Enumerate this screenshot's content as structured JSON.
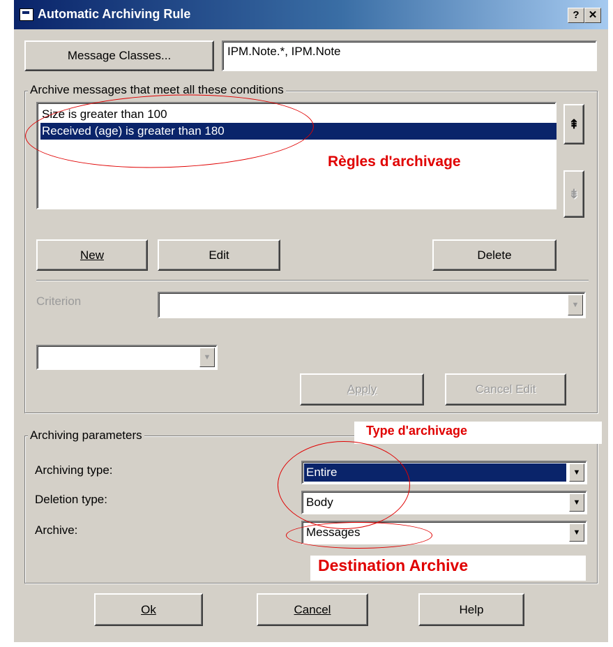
{
  "window": {
    "title": "Automatic Archiving Rule",
    "help_caption": "?",
    "close_caption": "✕"
  },
  "message_classes": {
    "button_label": "Message Classes...",
    "value": "IPM.Note.*, IPM.Note"
  },
  "conditions": {
    "group_label": "Archive messages that meet all these conditions",
    "items": [
      {
        "text": "Size is greater than 100",
        "selected": false
      },
      {
        "text": "Received (age) is greater than 180",
        "selected": true
      }
    ],
    "move_up_icon": "move-up-icon",
    "move_down_icon": "move-down-icon",
    "new_label": "New",
    "edit_label": "Edit",
    "delete_label": "Delete",
    "criterion_label": "Criterion",
    "criterion_value": "",
    "operator_value": "",
    "apply_label": "Apply",
    "cancel_edit_label": "Cancel Edit"
  },
  "parameters": {
    "group_label": "Archiving parameters",
    "archiving_type_label": "Archiving type:",
    "archiving_type_value": "Entire",
    "deletion_type_label": "Deletion type:",
    "deletion_type_value": "Body",
    "archive_label": "Archive:",
    "archive_value": "Messages"
  },
  "footer": {
    "ok_label": "Ok",
    "cancel_label": "Cancel",
    "help_label": "Help"
  },
  "annotations": {
    "rules": "Règles d'archivage",
    "type": "Type d'archivage",
    "destination": "Destination Archive",
    "color": "#e00000"
  },
  "colors": {
    "face": "#d4d0c8",
    "selection": "#0a246a",
    "title_start": "#0a246a",
    "title_end": "#a6caf0"
  }
}
